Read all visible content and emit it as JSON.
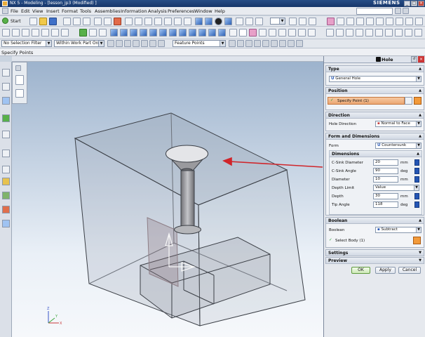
{
  "titlebar": {
    "title": "NX 5 - Modeling - [lesson_jp3 (Modified) ]",
    "brand": "SIEMENS"
  },
  "menu": [
    "File",
    "Edit",
    "View",
    "Insert",
    "Format",
    "Tools",
    "Assemblies",
    "Information",
    "Analysis",
    "Preferences",
    "Window",
    "Help"
  ],
  "toolbar": {
    "start_label": "Start"
  },
  "filters": {
    "selection_filter": "No Selection Filter",
    "scope": "Within Work Part Only",
    "snap": "Feature Points"
  },
  "prompt": "Specify Points",
  "dialog": {
    "title": "Hole",
    "type": {
      "header": "Type",
      "value": "General Hole"
    },
    "position": {
      "header": "Position",
      "label": "Specify Point (1)"
    },
    "direction": {
      "header": "Direction",
      "label": "Hole Direction",
      "value": "Normal to Face"
    },
    "form": {
      "header": "Form and Dimensions",
      "label": "Form",
      "value": "Countersunk",
      "dims_header": "Dimensions",
      "rows": [
        {
          "label": "C-Sink Diameter",
          "value": "20",
          "unit": "mm"
        },
        {
          "label": "C-Sink Angle",
          "value": "90",
          "unit": "deg"
        },
        {
          "label": "Diameter",
          "value": "10",
          "unit": "mm"
        },
        {
          "label": "Depth Limit",
          "value": "Value",
          "unit": ""
        },
        {
          "label": "Depth",
          "value": "30",
          "unit": "mm"
        },
        {
          "label": "Tip Angle",
          "value": "118",
          "unit": "deg"
        }
      ]
    },
    "boolean": {
      "header": "Boolean",
      "label": "Boolean",
      "value": "Subtract",
      "select": "Select Body (1)"
    },
    "settings": "Settings",
    "preview": "Preview",
    "ok": "OK",
    "apply": "Apply",
    "cancel": "Cancel"
  },
  "triad": {
    "x": "X",
    "y": "Y",
    "z": "Z"
  }
}
